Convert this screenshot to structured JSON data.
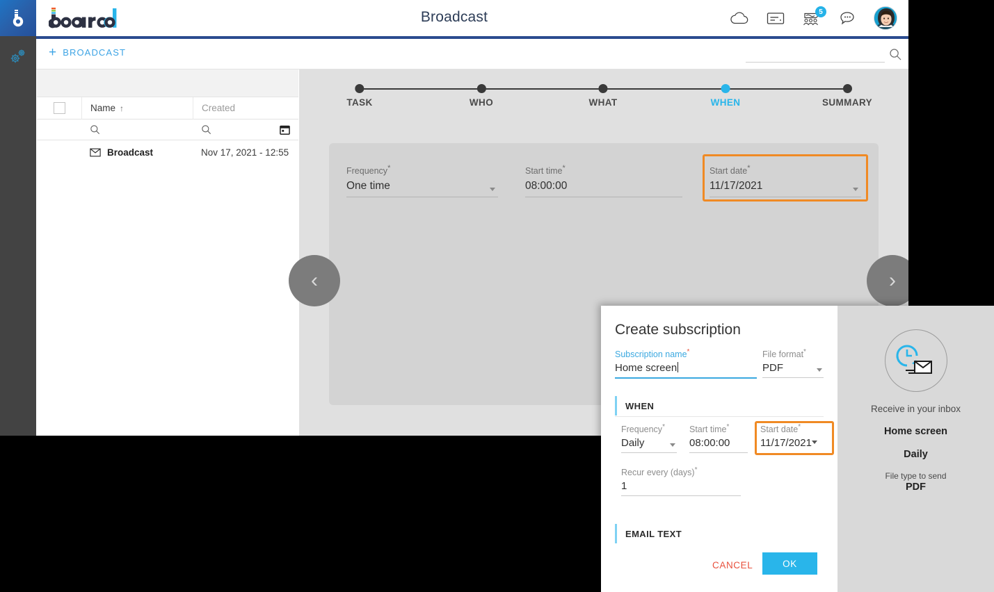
{
  "app": {
    "logo_alt": "board",
    "title": "Broadcast",
    "badge_count": "5",
    "icons": {
      "cloud": "cloud-icon",
      "card": "note-card-icon",
      "broadcast": "broadcast-group-icon",
      "chat": "chat-bubble-icon",
      "avatar": "user-avatar",
      "settings": "gears-icon"
    }
  },
  "toolbar": {
    "new_label": "BROADCAST",
    "plus": "+",
    "search_value": "",
    "search_placeholder": ""
  },
  "list_panel": {
    "columns": [
      "Name",
      "Created"
    ],
    "sort_indicator": "↑",
    "rows": [
      {
        "icon": "envelope-icon",
        "name": "Broadcast",
        "created": "Nov 17, 2021 - 12:55"
      }
    ]
  },
  "wizard": {
    "steps": [
      {
        "label": "TASK",
        "active": false
      },
      {
        "label": "WHO",
        "active": false
      },
      {
        "label": "WHAT",
        "active": false
      },
      {
        "label": "WHEN",
        "active": true
      },
      {
        "label": "SUMMARY",
        "active": false
      }
    ],
    "fields": {
      "frequency_label": "Frequency",
      "frequency_value": "One time",
      "start_time_label": "Start time",
      "start_time_value": "08:00:00",
      "start_date_label": "Start date",
      "start_date_value": "11/17/2021",
      "required_mark": "*"
    },
    "nav": {
      "prev": "‹",
      "next": "›"
    }
  },
  "modal": {
    "title": "Create subscription",
    "required_mark": "*",
    "subscription_name_label": "Subscription name",
    "subscription_name_value": "Home screen",
    "file_format_label": "File format",
    "file_format_value": "PDF",
    "when_section": "WHEN",
    "frequency_label": "Frequency",
    "frequency_value": "Daily",
    "start_time_label": "Start time",
    "start_time_value": "08:00:00",
    "start_date_label": "Start date",
    "start_date_value": "11/17/2021",
    "recur_label": "Recur every (days)",
    "recur_value": "1",
    "email_section": "EMAIL TEXT",
    "cancel_label": "CANCEL",
    "ok_label": "OK",
    "preview": {
      "icon": "clock-envelope-icon",
      "caption": "Receive in your inbox",
      "name": "Home screen",
      "frequency": "Daily",
      "filetype_label": "File type to send",
      "filetype_value": "PDF"
    }
  },
  "colors": {
    "accent": "#29b5ea",
    "highlight": "#f08a24",
    "danger": "#e8503c",
    "rail": "#434343"
  }
}
